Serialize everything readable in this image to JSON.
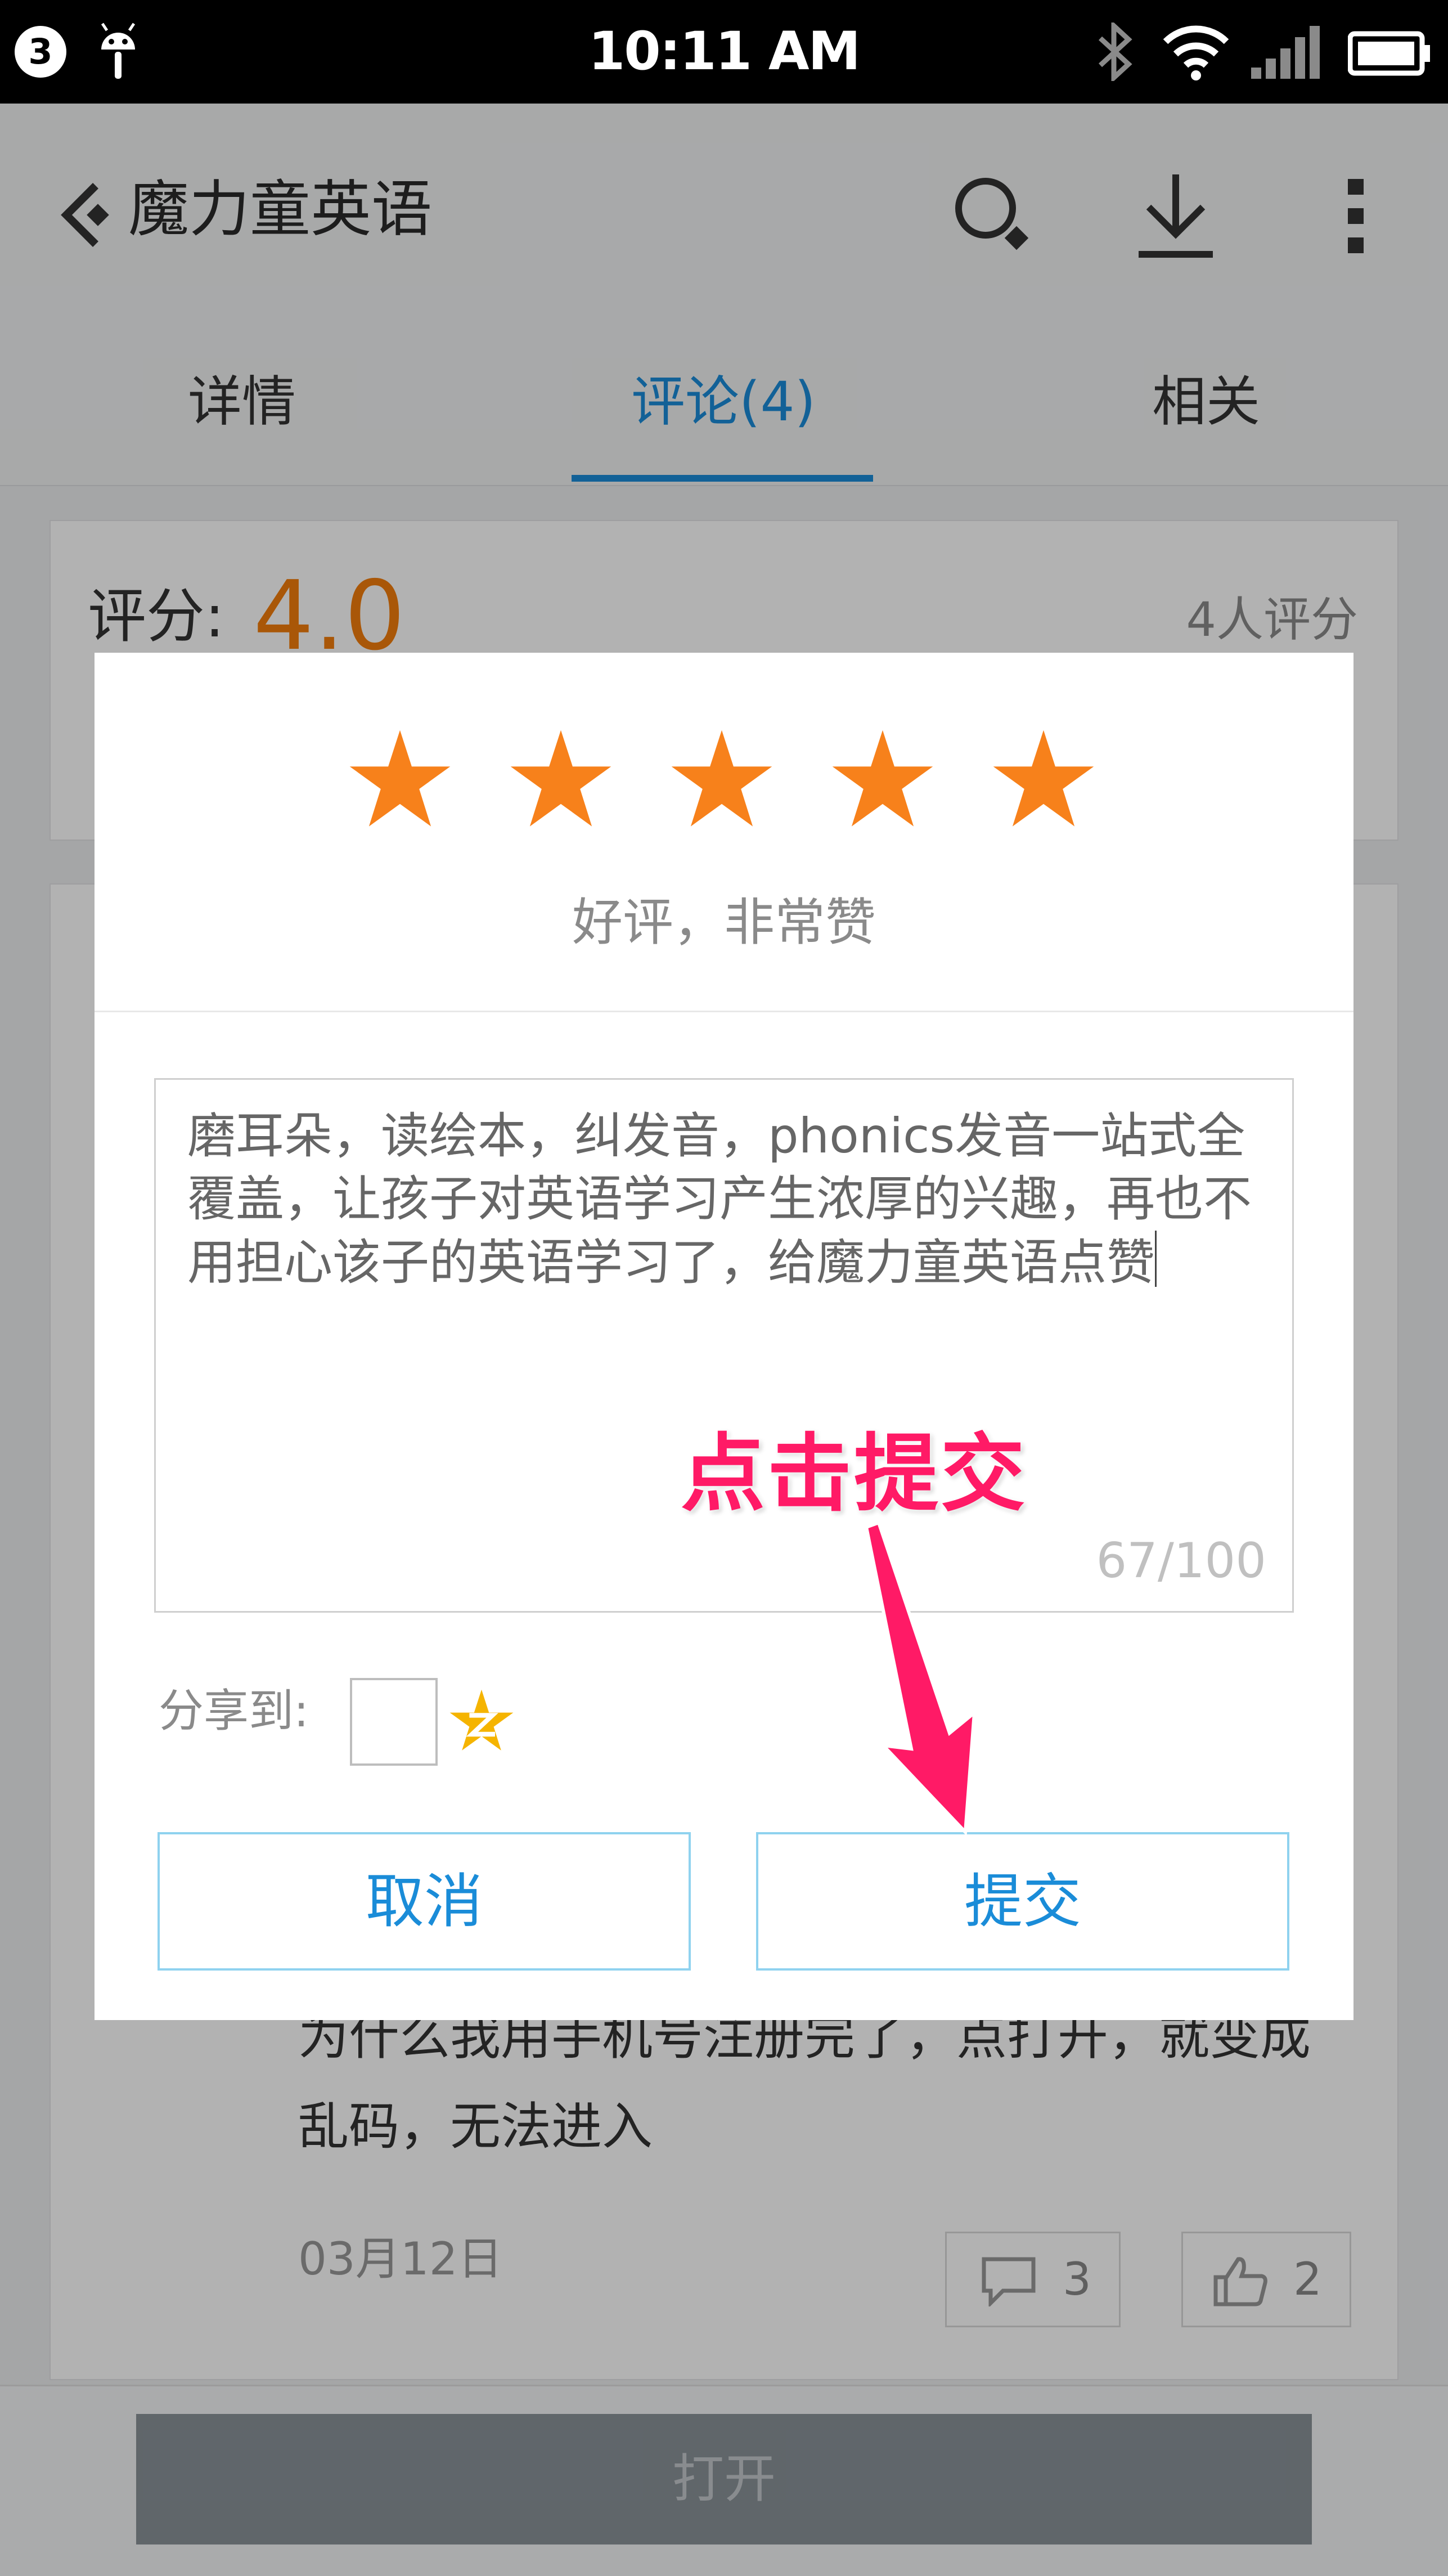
{
  "status_bar": {
    "notification_count": "3",
    "time": "10:11 AM"
  },
  "app_bar": {
    "title": "魔力童英语"
  },
  "tabs": [
    {
      "label": "详情",
      "active": false
    },
    {
      "label": "评论(4)",
      "active": true
    },
    {
      "label": "相关",
      "active": false
    }
  ],
  "rating": {
    "label": "评分:",
    "value": "4.0",
    "count": "4人评分"
  },
  "comment": {
    "text": "为什么我用手机号注册完了，点打开，就变成乱码，无法进入",
    "date": "03月12日",
    "reply_count": "3",
    "like_count": "2"
  },
  "bottom": {
    "open_label": "打开"
  },
  "dialog": {
    "stars_selected": 5,
    "stars_total": 5,
    "rating_caption": "好评，非常赞",
    "review_text": "磨耳朵，读绘本，纠发音，phonics发音一站式全覆盖，让孩子对英语学习产生浓厚的兴趣，再也不用担心该子的英语学习了，给魔力童英语点赞",
    "char_count": "67/100",
    "share_label": "分享到:",
    "cancel_label": "取消",
    "submit_label": "提交"
  },
  "annotation": {
    "text": "点击提交"
  },
  "colors": {
    "accent": "#1a8cd8",
    "star": "#f7811b",
    "rating_value": "#f27d0c",
    "annotation": "#ff1a66",
    "button_border": "#8fd2ef"
  }
}
